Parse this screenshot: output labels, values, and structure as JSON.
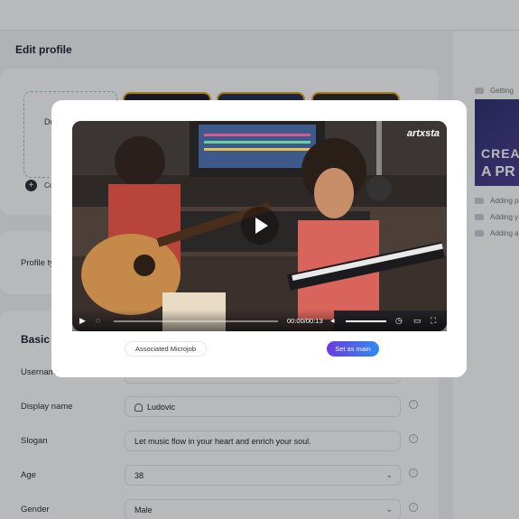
{
  "page": {
    "title": "Edit profile",
    "colors": {
      "accent_start": "#6b3be0",
      "accent_end": "#2f8bf0",
      "thumb_border": "#e7a628"
    }
  },
  "media": {
    "drop_label_start": "Dr",
    "add_label_start": "Co"
  },
  "profile_type": {
    "label_start": "Profile ty"
  },
  "basic": {
    "title_start": "Basic i",
    "fields": [
      {
        "label": "Usernam",
        "value": ""
      },
      {
        "label": "Display name",
        "value": "Ludovic",
        "icon": "user-icon"
      },
      {
        "label": "Slogan",
        "value": "Let music flow in your heart and enrich your soul."
      },
      {
        "label": "Age",
        "value": "38",
        "icon": "chevron-down-icon"
      },
      {
        "label": "Gender",
        "value": "Male",
        "icon": "chevron-down-icon"
      }
    ]
  },
  "sidebar": {
    "items": [
      {
        "label": "Getting"
      },
      {
        "label": "Adding p"
      },
      {
        "label": "Adding y"
      },
      {
        "label": "Adding a"
      }
    ],
    "promo_line1": "CREA",
    "promo_line2": "A PR"
  },
  "modal": {
    "brand": "artxsta",
    "time": "00:00/00:13",
    "volume": 1.0,
    "progress": 0.0,
    "buttons": {
      "associated": "Associated Microjob",
      "set_main": "Set as main"
    }
  }
}
